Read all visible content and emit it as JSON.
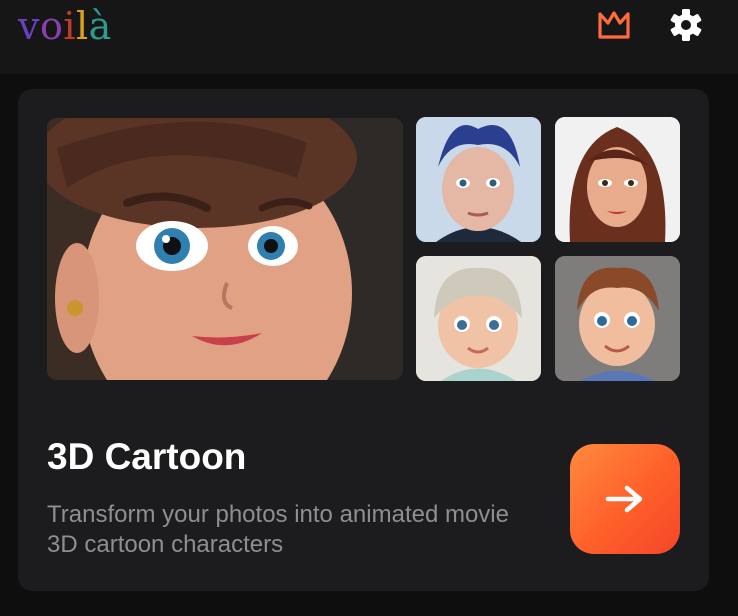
{
  "header": {
    "logo_text": [
      "v",
      "o",
      "i",
      "l",
      "à"
    ],
    "logo_colors": [
      "#6a3fc4",
      "#8a3fb0",
      "#c0392b",
      "#d9a21b",
      "#2a9d8f"
    ],
    "premium_icon": "crown-icon",
    "settings_icon": "gear-icon"
  },
  "card": {
    "images": {
      "hero": "woman-3d-cartoon-portrait",
      "thumb_1": "man-blue-hair-cartoon",
      "thumb_2": "woman-brown-hair-cartoon",
      "thumb_3": "baby-beanie-cartoon",
      "thumb_4": "boy-cartoon"
    },
    "title": "3D Cartoon",
    "description": "Transform your photos into animated movie 3D cartoon characters",
    "go_icon": "arrow-right-icon"
  },
  "colors": {
    "accent": "#ff6a30",
    "crown": "#ff6b3d",
    "background": "#0e0e0f",
    "card": "#1c1c1e",
    "header": "#161617"
  }
}
